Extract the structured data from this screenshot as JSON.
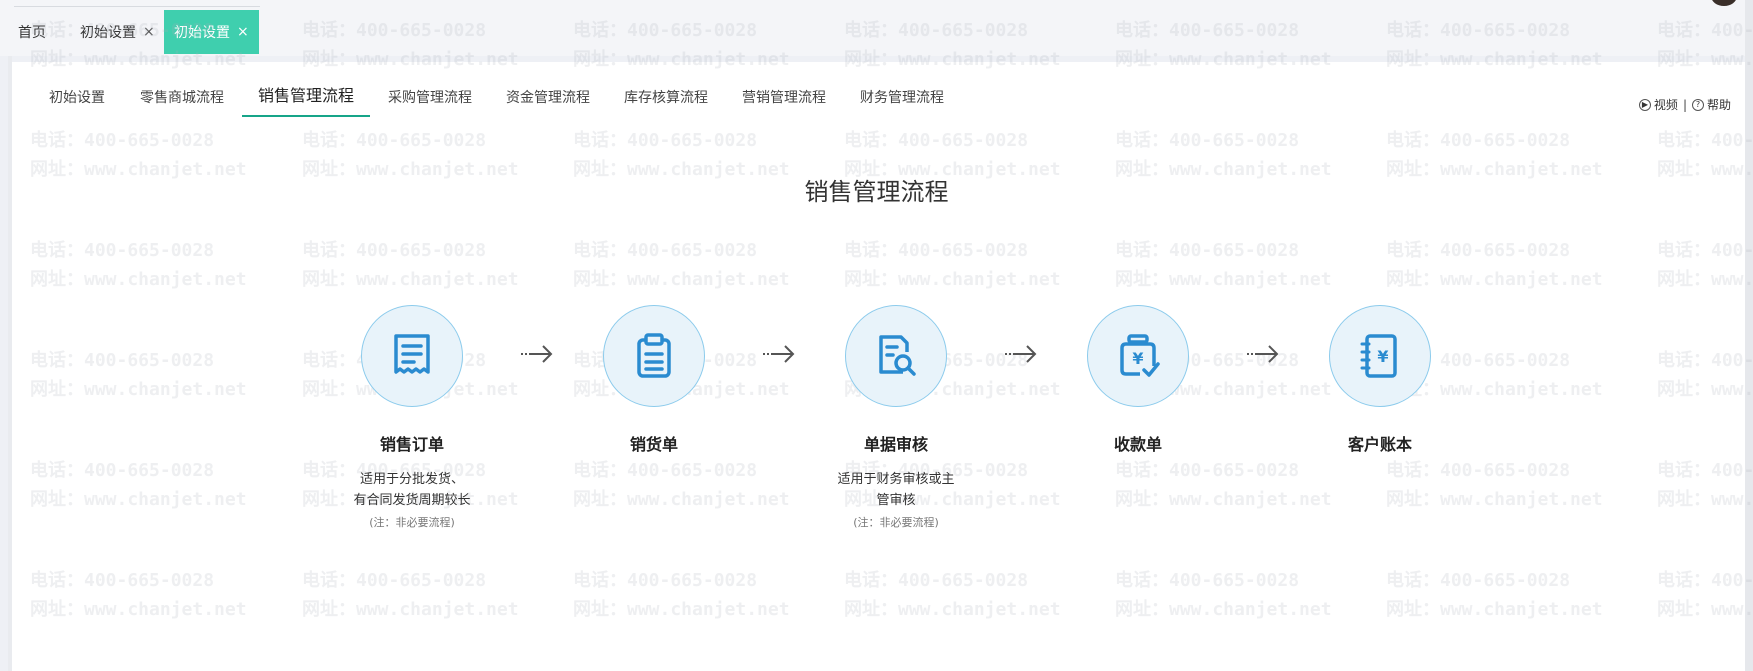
{
  "top_tabs": [
    {
      "label": "首页"
    },
    {
      "label": "初始设置",
      "close": "×"
    },
    {
      "label": "初始设置",
      "close": "×"
    }
  ],
  "watermark": {
    "phone": "电话：400-665-0028",
    "site": "网址：www.chanjet.net"
  },
  "sub_tabs": [
    "初始设置",
    "零售商城流程",
    "销售管理流程",
    "采购管理流程",
    "资金管理流程",
    "库存核算流程",
    "营销管理流程",
    "财务管理流程"
  ],
  "helpers": {
    "video": "视频",
    "separator": "|",
    "help": "帮助"
  },
  "flow": {
    "title": "销售管理流程",
    "steps": [
      {
        "name": "销售订单",
        "desc1": "适用于分批发货、",
        "desc2": "有合同发货周期较长",
        "note": "(注：非必要流程)",
        "icon": "receipt-icon"
      },
      {
        "name": "销货单",
        "desc1": "",
        "desc2": "",
        "note": "",
        "icon": "clipboard-icon"
      },
      {
        "name": "单据审核",
        "desc1": "适用于财务审核或主",
        "desc2": "管审核",
        "note": "(注：非必要流程)",
        "icon": "document-search-icon"
      },
      {
        "name": "收款单",
        "desc1": "",
        "desc2": "",
        "note": "",
        "icon": "money-bag-icon"
      },
      {
        "name": "客户账本",
        "desc1": "",
        "desc2": "",
        "note": "",
        "icon": "ledger-icon"
      }
    ]
  },
  "colors": {
    "accent": "#3fcfae",
    "underline": "#17a589",
    "icon_blue": "#2a8bd0",
    "circle_bg": "#e8f3fa"
  }
}
